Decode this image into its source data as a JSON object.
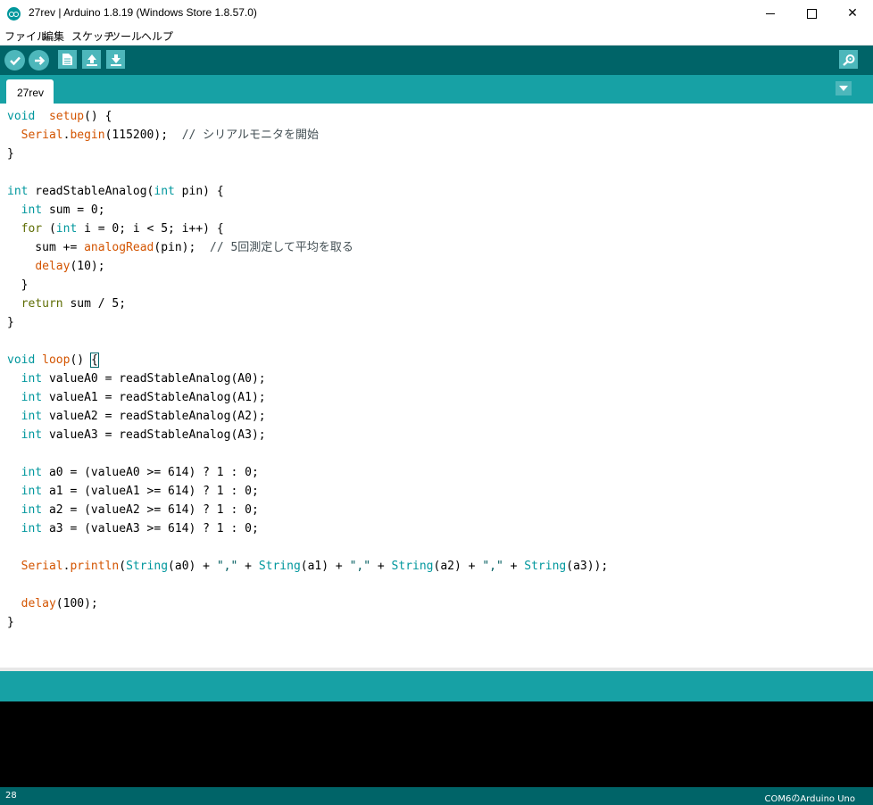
{
  "window": {
    "title": "27rev | Arduino 1.8.19 (Windows Store 1.8.57.0)",
    "controls": {
      "minimize": "minimize",
      "maximize": "maximize",
      "close": "✕"
    }
  },
  "menu": [
    "ファイル",
    "編集",
    "スケッチ",
    "ツール",
    "ヘルプ"
  ],
  "toolbar": {
    "buttons": [
      "verify-icon",
      "upload-icon",
      "new-file-icon",
      "open-icon",
      "save-icon"
    ],
    "right_button": "serial-monitor-icon"
  },
  "tabs": [
    {
      "label": "27rev"
    }
  ],
  "code_lines": [
    [
      [
        "kw-type",
        "void"
      ],
      [
        "",
        "  "
      ],
      [
        "fn",
        "setup"
      ],
      [
        "",
        "() {"
      ]
    ],
    [
      [
        "",
        "  "
      ],
      [
        "fn",
        "Serial"
      ],
      [
        "",
        "."
      ],
      [
        "fn",
        "begin"
      ],
      [
        "",
        "(115200);  "
      ],
      [
        "cmt",
        "// シリアルモニタを開始"
      ]
    ],
    [
      [
        "",
        "}"
      ]
    ],
    [],
    [
      [
        "kw-type",
        "int"
      ],
      [
        "",
        " readStableAnalog("
      ],
      [
        "kw-type",
        "int"
      ],
      [
        "",
        " pin) {"
      ]
    ],
    [
      [
        "",
        "  "
      ],
      [
        "kw-type",
        "int"
      ],
      [
        "",
        " sum = 0;"
      ]
    ],
    [
      [
        "",
        "  "
      ],
      [
        "kw-ctl",
        "for"
      ],
      [
        "",
        " ("
      ],
      [
        "kw-type",
        "int"
      ],
      [
        "",
        " i = 0; i < 5; i++) {"
      ]
    ],
    [
      [
        "",
        "    sum += "
      ],
      [
        "fn",
        "analogRead"
      ],
      [
        "",
        "(pin);  "
      ],
      [
        "cmt",
        "// 5回測定して平均を取る"
      ]
    ],
    [
      [
        "",
        "    "
      ],
      [
        "fn",
        "delay"
      ],
      [
        "",
        "(10);"
      ]
    ],
    [
      [
        "",
        "  }"
      ]
    ],
    [
      [
        "",
        "  "
      ],
      [
        "kw-ctl",
        "return"
      ],
      [
        "",
        " sum / 5;"
      ]
    ],
    [
      [
        "",
        "}"
      ]
    ],
    [],
    [
      [
        "kw-type",
        "void"
      ],
      [
        "",
        " "
      ],
      [
        "fn",
        "loop"
      ],
      [
        "",
        "() "
      ],
      [
        "caret-brace",
        "{"
      ]
    ],
    [
      [
        "",
        "  "
      ],
      [
        "kw-type",
        "int"
      ],
      [
        "",
        " valueA0 = readStableAnalog(A0);"
      ]
    ],
    [
      [
        "",
        "  "
      ],
      [
        "kw-type",
        "int"
      ],
      [
        "",
        " valueA1 = readStableAnalog(A1);"
      ]
    ],
    [
      [
        "",
        "  "
      ],
      [
        "kw-type",
        "int"
      ],
      [
        "",
        " valueA2 = readStableAnalog(A2);"
      ]
    ],
    [
      [
        "",
        "  "
      ],
      [
        "kw-type",
        "int"
      ],
      [
        "",
        " valueA3 = readStableAnalog(A3);"
      ]
    ],
    [],
    [
      [
        "",
        "  "
      ],
      [
        "kw-type",
        "int"
      ],
      [
        "",
        " a0 = (valueA0 >= 614) ? 1 : 0;"
      ]
    ],
    [
      [
        "",
        "  "
      ],
      [
        "kw-type",
        "int"
      ],
      [
        "",
        " a1 = (valueA1 >= 614) ? 1 : 0;"
      ]
    ],
    [
      [
        "",
        "  "
      ],
      [
        "kw-type",
        "int"
      ],
      [
        "",
        " a2 = (valueA2 >= 614) ? 1 : 0;"
      ]
    ],
    [
      [
        "",
        "  "
      ],
      [
        "kw-type",
        "int"
      ],
      [
        "",
        " a3 = (valueA3 >= 614) ? 1 : 0;"
      ]
    ],
    [],
    [
      [
        "",
        "  "
      ],
      [
        "fn",
        "Serial"
      ],
      [
        "",
        "."
      ],
      [
        "fn",
        "println"
      ],
      [
        "",
        "("
      ],
      [
        "kw-type",
        "String"
      ],
      [
        "",
        "(a0) + "
      ],
      [
        "str",
        "\",\""
      ],
      [
        "",
        " + "
      ],
      [
        "kw-type",
        "String"
      ],
      [
        "",
        "(a1) + "
      ],
      [
        "str",
        "\",\""
      ],
      [
        "",
        " + "
      ],
      [
        "kw-type",
        "String"
      ],
      [
        "",
        "(a2) + "
      ],
      [
        "str",
        "\",\""
      ],
      [
        "",
        " + "
      ],
      [
        "kw-type",
        "String"
      ],
      [
        "",
        "(a3));"
      ]
    ],
    [],
    [
      [
        "",
        "  "
      ],
      [
        "fn",
        "delay"
      ],
      [
        "",
        "(100);"
      ]
    ],
    [
      [
        "",
        "}"
      ]
    ]
  ],
  "status": {
    "line": "28",
    "board": "COM6のArduino Uno"
  },
  "colors": {
    "toolbar": "#006468",
    "tabbar": "#17a1a5",
    "button": "#4db7bb",
    "keyword_type": "#00979d",
    "keyword_control": "#5e6d03",
    "function": "#d35400"
  }
}
